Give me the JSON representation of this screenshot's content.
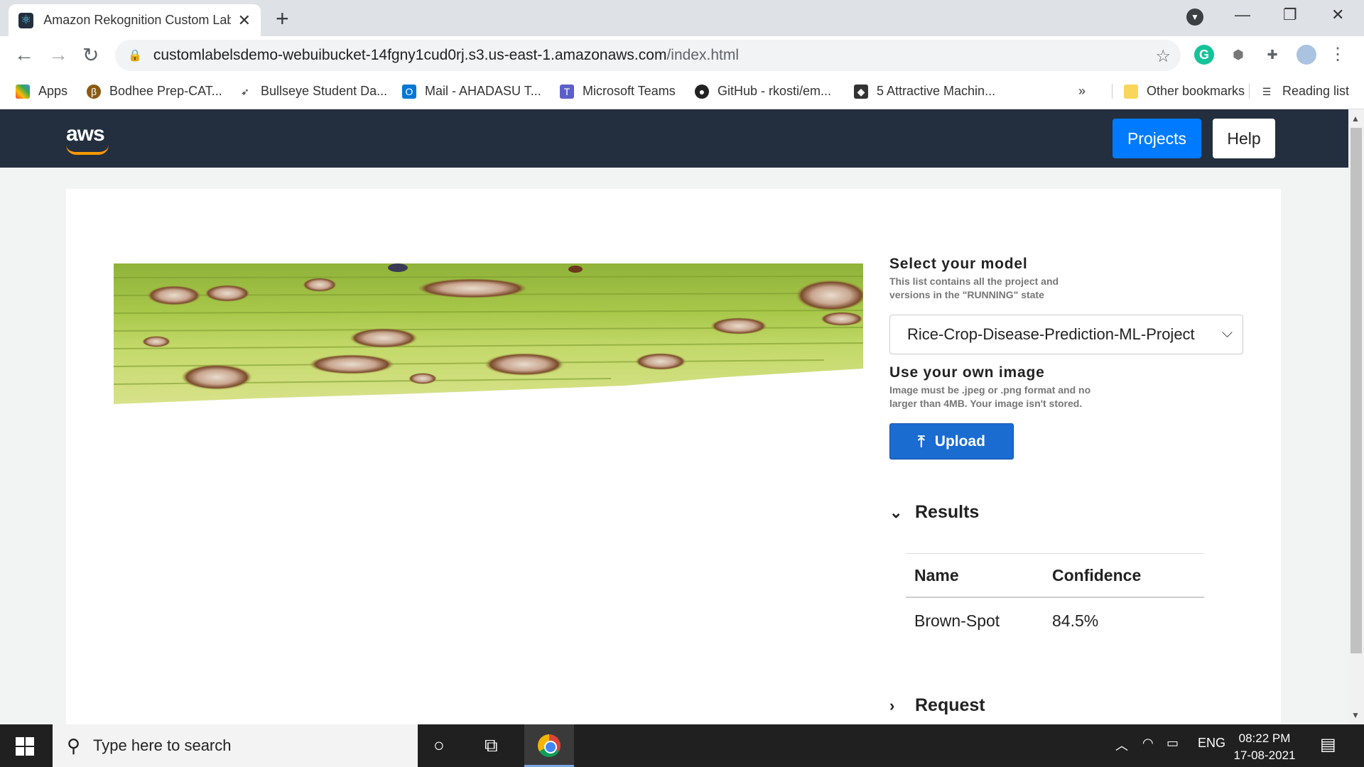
{
  "browser": {
    "tab_title": "Amazon Rekognition Custom Labels",
    "tab_close": "✕",
    "new_tab": "+",
    "url_host": "customlabelsdemo-webuibucket-14fgny1cud0rj.s3.us-east-1.amazonaws.com",
    "url_path": "/index.html",
    "bookmarks": [
      {
        "label": "Apps",
        "icon": "apps-grid-icon"
      },
      {
        "label": "Bodhee Prep-CAT...",
        "icon": "bodhee-icon"
      },
      {
        "label": "Bullseye Student Da...",
        "icon": "bullseye-icon"
      },
      {
        "label": "Mail - AHADASU T...",
        "icon": "outlook-icon"
      },
      {
        "label": "Microsoft Teams",
        "icon": "teams-icon"
      },
      {
        "label": "GitHub - rkosti/em...",
        "icon": "github-icon"
      },
      {
        "label": "5 Attractive Machin...",
        "icon": "ml-icon"
      }
    ],
    "bookmarks_overflow": "»",
    "other_bookmarks": "Other bookmarks",
    "reading_list": "Reading list"
  },
  "header": {
    "logo_text": "aws",
    "projects_button": "Projects",
    "help_button": "Help"
  },
  "model": {
    "title": "Select your model",
    "hint": "This list contains all the project and versions in the \"RUNNING\" state",
    "selected": "Rice-Crop-Disease-Prediction-ML-Project"
  },
  "upload": {
    "title": "Use your own image",
    "hint": "Image must be .jpeg or .png format and no larger than 4MB. Your image isn't stored.",
    "button": "Upload"
  },
  "results": {
    "title": "Results",
    "columns": [
      "Name",
      "Confidence"
    ],
    "rows": [
      {
        "name": "Brown-Spot",
        "confidence": "84.5%"
      }
    ]
  },
  "request": {
    "title": "Request"
  },
  "taskbar": {
    "search_placeholder": "Type here to search",
    "language": "ENG",
    "time": "08:22 PM",
    "date": "17-08-2021"
  },
  "colors": {
    "aws_nav": "#232f3e",
    "projects_button": "#007bff",
    "upload_button": "#1a6cd1",
    "aws_smile": "#ff9900"
  }
}
